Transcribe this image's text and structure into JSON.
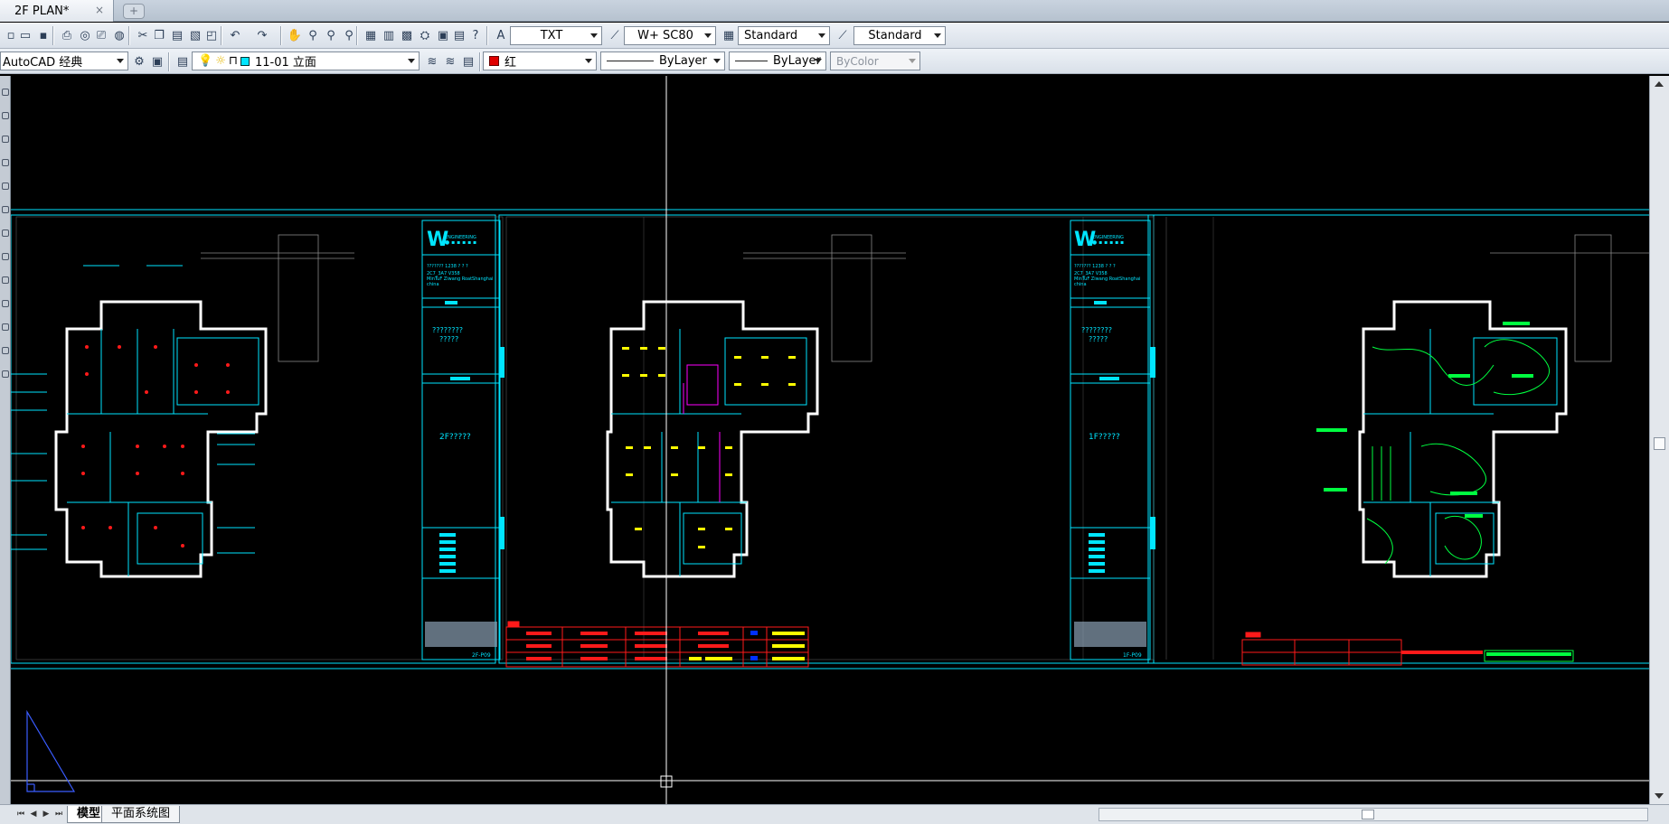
{
  "document_tab": {
    "title": "2F PLAN*",
    "close_glyph": "×"
  },
  "new_tab_glyph": "+",
  "toolbar_row1": {
    "buttons": [
      "new-icon",
      "open-icon",
      "save-icon",
      "print-icon",
      "print-preview-icon",
      "plot-icon",
      "publish-icon",
      "cut-icon",
      "copy-icon",
      "paste-icon",
      "match-properties-icon",
      "block-editor-icon",
      "undo-icon",
      "redo-icon",
      "pan-icon",
      "zoom-realtime-icon",
      "zoom-window-icon",
      "zoom-previous-icon",
      "properties-icon",
      "design-center-icon",
      "tool-palettes-icon",
      "sheet-set-icon",
      "markup-icon",
      "quickcalc-icon",
      "help-icon"
    ],
    "text_style": "TXT",
    "dim_style": "W+ SC80",
    "table_style": "Standard",
    "multileader_style": "Standard"
  },
  "toolbar_row2": {
    "workspace": "AutoCAD 经典",
    "layer": "11-01 立面",
    "color": "红",
    "linetype": "ByLayer",
    "lineweight": "ByLayer",
    "plot_style": "ByColor"
  },
  "sheets": [
    {
      "title_block": {
        "project_text": "??????? 1238 ? ? ?",
        "address_line1": "2C7_3A7 V358",
        "address_line2": "MinTuF Ziwang RoatShanghai",
        "address_line3": "china",
        "drawing_name": "????????",
        "drawing_name2": "?????",
        "content_label": "2F?????",
        "drawing_no": "2F-P09"
      }
    },
    {
      "title_block": {
        "project_text": "??????? 1238 ? ? ?",
        "address_line1": "2C7_3A7 V358",
        "address_line2": "MinTuF Ziwang RoatShanghai",
        "address_line3": "china",
        "drawing_name": "????????",
        "drawing_name2": "?????",
        "content_label": "1F?????",
        "drawing_no": "1F-P09"
      }
    }
  ],
  "layout_tabs": [
    "模型",
    "平面系统图"
  ],
  "colors": {
    "cyan": "#00e5ff",
    "red": "#ff1a1a",
    "yellow": "#ffff00",
    "green": "#00ff40",
    "magenta": "#ff00ff",
    "white": "#ffffff"
  }
}
